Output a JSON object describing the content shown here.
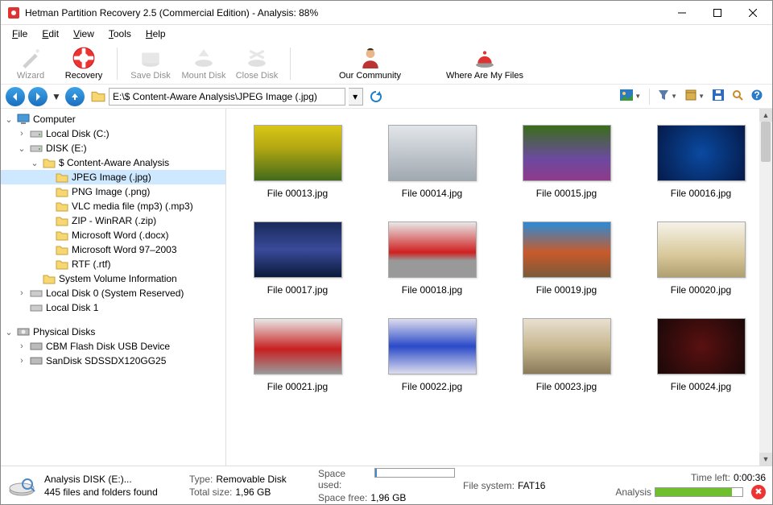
{
  "window": {
    "title": "Hetman Partition Recovery 2.5 (Commercial Edition) - Analysis: 88%"
  },
  "menu": {
    "file": "File",
    "edit": "Edit",
    "view": "View",
    "tools": "Tools",
    "help": "Help"
  },
  "toolbar": {
    "wizard": "Wizard",
    "recovery": "Recovery",
    "save_disk": "Save Disk",
    "mount_disk": "Mount Disk",
    "close_disk": "Close Disk",
    "community": "Our Community",
    "where": "Where Are My Files"
  },
  "address": {
    "value": "E:\\$ Content-Aware Analysis\\JPEG Image (.jpg)"
  },
  "tree": {
    "computer": "Computer",
    "local_c": "Local Disk (C:)",
    "disk_e": "DISK (E:)",
    "caa": "$ Content-Aware Analysis",
    "jpeg": "JPEG Image (.jpg)",
    "png": "PNG Image (.png)",
    "vlc": "VLC media file (mp3) (.mp3)",
    "zip": "ZIP - WinRAR (.zip)",
    "docx": "Microsoft Word (.docx)",
    "doc": "Microsoft Word 97–2003",
    "rtf": "RTF (.rtf)",
    "svi": "System Volume Information",
    "ld0": "Local Disk 0 (System Reserved)",
    "ld1": "Local Disk 1",
    "phys": "Physical Disks",
    "cbm": "CBM Flash Disk USB Device",
    "sandisk": "SanDisk SDSSDX120GG25"
  },
  "files": [
    {
      "name": "File 00013.jpg",
      "bg": "linear-gradient(#d9c616,#b3a812 40%,#426b1b)"
    },
    {
      "name": "File 00014.jpg",
      "bg": "linear-gradient(#e2e6ea,#a0a8b0)"
    },
    {
      "name": "File 00015.jpg",
      "bg": "linear-gradient(#3a6d1a 0%,#6b4aa0 60%,#8f3a8a)"
    },
    {
      "name": "File 00016.jpg",
      "bg": "radial-gradient(circle,#0a4aa0,#051a4a)"
    },
    {
      "name": "File 00017.jpg",
      "bg": "linear-gradient(#1a2a5a 0%,#3a4a9a 50%,#0a1a3a)"
    },
    {
      "name": "File 00018.jpg",
      "bg": "linear-gradient(#e8e8e8 0%,#d02020 55%,#999 70%)"
    },
    {
      "name": "File 00019.jpg",
      "bg": "linear-gradient(#2a8bd8 0%,#c85a2a 55%,#7a5a3a)"
    },
    {
      "name": "File 00020.jpg",
      "bg": "linear-gradient(#f5f2e8 0%,#d8c89a 60%,#b0a070)"
    },
    {
      "name": "File 00021.jpg",
      "bg": "linear-gradient(#e8e8e8 0%,#c82020 55%,#999)"
    },
    {
      "name": "File 00022.jpg",
      "bg": "linear-gradient(#dde 0%,#2a4ac8 50%,#dde)"
    },
    {
      "name": "File 00023.jpg",
      "bg": "linear-gradient(#e8e0d0 0%,#c8b890 50%,#8a7a5a)"
    },
    {
      "name": "File 00024.jpg",
      "bg": "radial-gradient(circle,#5a1010,#1a0808)"
    }
  ],
  "status": {
    "analysis_label": "Analysis DISK (E:)...",
    "found": "445 files and folders found",
    "type_k": "Type:",
    "type_v": "Removable Disk",
    "total_k": "Total size:",
    "total_v": "1,96 GB",
    "used_k": "Space used:",
    "free_k": "Space free:",
    "free_v": "1,96 GB",
    "fs_k": "File system:",
    "fs_v": "FAT16",
    "time_k": "Time left:",
    "time_v": "0:00:36",
    "analysis_k": "Analysis",
    "progress_pct": 88
  }
}
